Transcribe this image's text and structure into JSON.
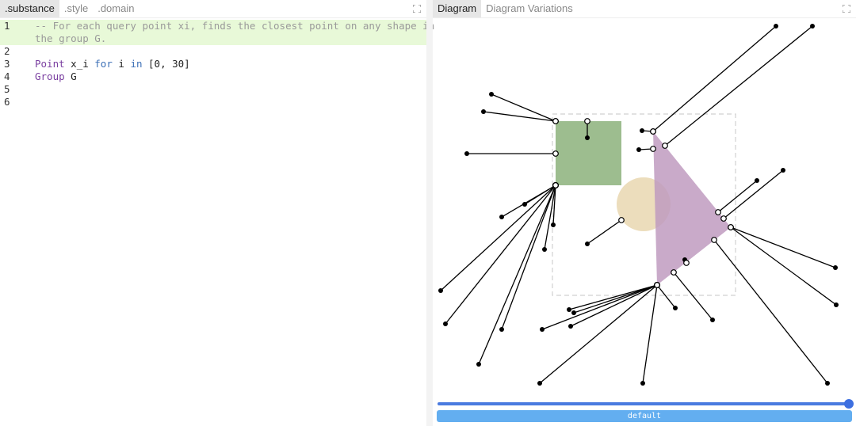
{
  "left_tabs": [
    ".substance",
    ".style",
    ".domain"
  ],
  "right_tabs": [
    "Diagram",
    "Diagram Variations"
  ],
  "editor": {
    "line_numbers": [
      "1",
      "2",
      "3",
      "4",
      "5",
      "6"
    ],
    "comment_line_1": "-- For each query point xi, finds the closest point on any shape in",
    "comment_line_2": "the group G.",
    "line3": {
      "kw_type": "Point",
      "text1": " x_i ",
      "kw": "for",
      "text2": " i ",
      "kw2": "in",
      "text3": " [0, 30]"
    },
    "line4": {
      "kw_type": "Group",
      "text1": " G"
    }
  },
  "colors": {
    "square_fill": "#9dbd8f",
    "circle_fill": "#ead9b5",
    "triangle_fill": "#c09bbf",
    "slider": "#4a7be0",
    "variation_button": "#63aef0",
    "highlight": "#e8f9d8"
  },
  "icons": {
    "left_expand": "expand-icon",
    "right_expand": "expand-icon"
  },
  "variation_button_label": "default",
  "slider_value": 1.0
}
